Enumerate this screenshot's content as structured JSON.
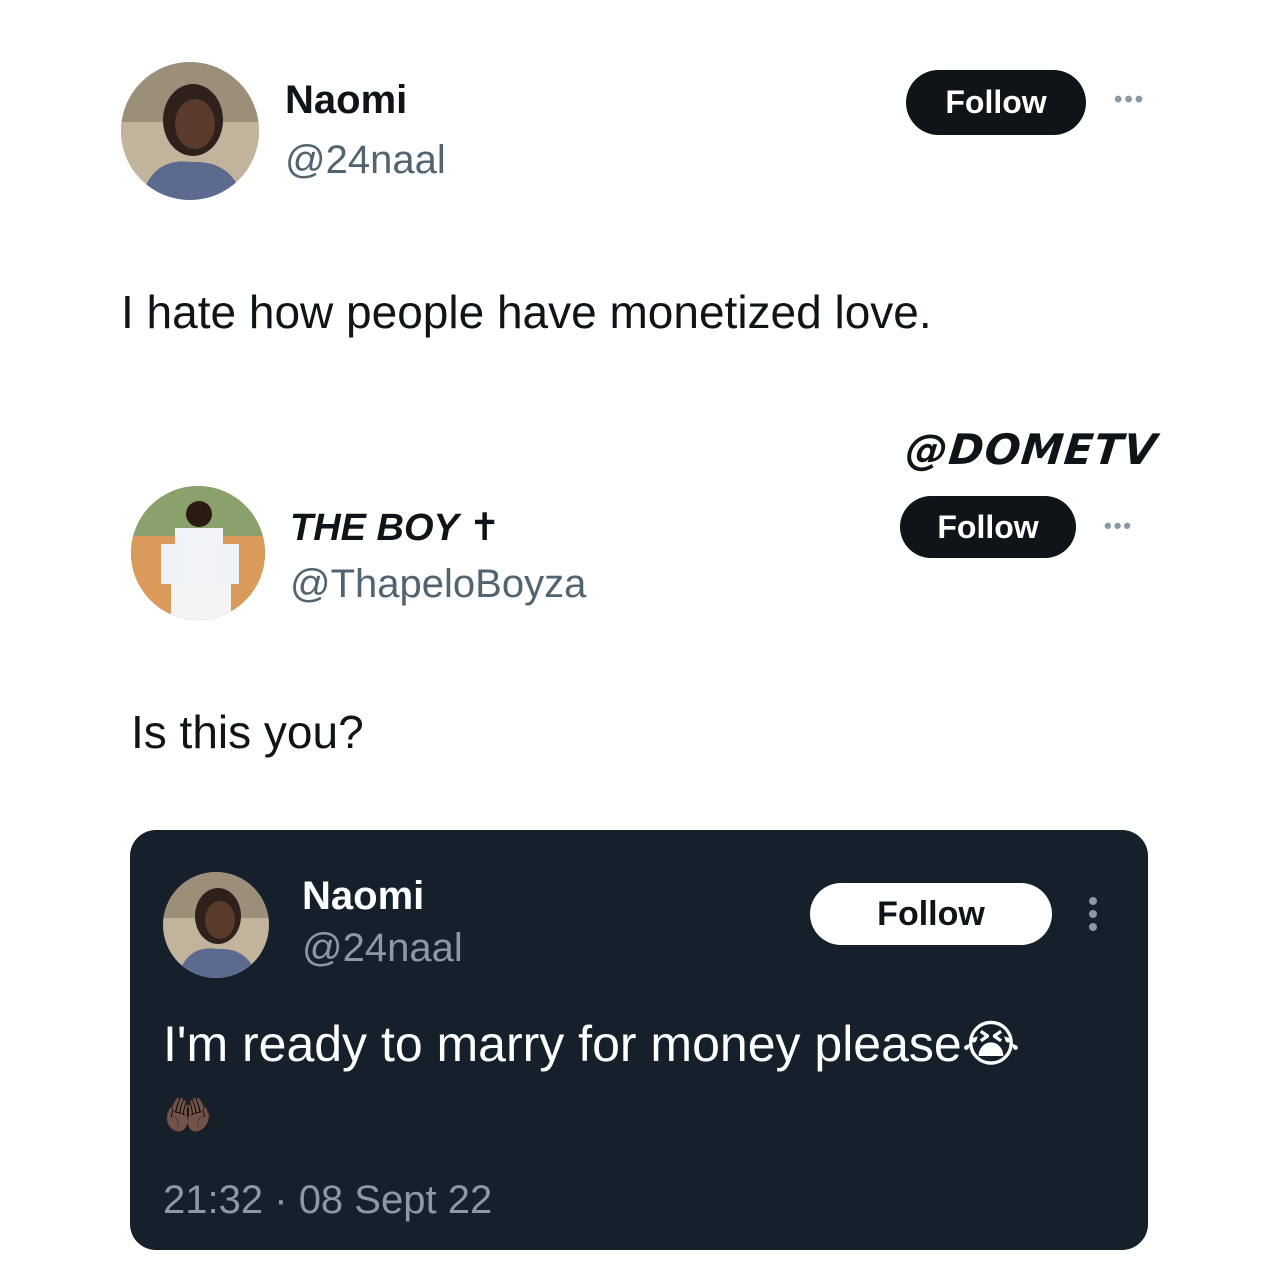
{
  "tweet1": {
    "name": "Naomi",
    "handle": "@24naal",
    "follow_label": "Follow",
    "text": "I hate how people have monetized love."
  },
  "watermark": "@DOMETV",
  "tweet2": {
    "name": "THE BOY",
    "name_badge": "✝",
    "handle": "@ThapeloBoyza",
    "follow_label": "Follow",
    "text": "Is this you?"
  },
  "quoted": {
    "name": "Naomi",
    "handle": "@24naal",
    "follow_label": "Follow",
    "text": "I'm ready to marry for money please",
    "emoji_1": "😭",
    "emoji_2": "🤲🏿",
    "time": "21:32",
    "separator": "·",
    "date": "08 Sept 22"
  },
  "icons": {
    "more": "more-horizontal-icon",
    "more_vertical": "more-vertical-icon"
  },
  "colors": {
    "dark_bg": "#15202b",
    "follow_dark": "#0f1419",
    "handle_gray": "#536471"
  }
}
